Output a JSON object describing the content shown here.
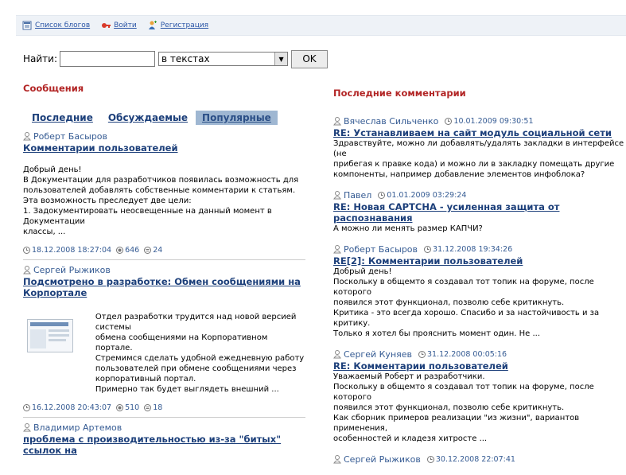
{
  "topnav": {
    "items": [
      {
        "label": "Список блогов",
        "icon": "blog-list-icon"
      },
      {
        "label": "Войти",
        "icon": "key-icon"
      },
      {
        "label": "Регистрация",
        "icon": "register-user-icon"
      }
    ]
  },
  "search": {
    "label": "Найти:",
    "query_value": "",
    "scope_selected": "в текстах",
    "ok_label": "OK"
  },
  "messages": {
    "title": "Сообщения",
    "tabs": [
      {
        "label": "Последние",
        "active": false
      },
      {
        "label": "Обсуждаемые",
        "active": false
      },
      {
        "label": "Популярные",
        "active": true
      }
    ],
    "posts": [
      {
        "author": "Роберт Басыров",
        "title": "Комментарии пользователей",
        "lines": [
          "Добрый день!",
          "В Документации для разработчиков появилась возможность для",
          "пользователей добавлять собственные комментарии к статьям.",
          "Эта возможность преследует две цели:",
          "1. Задокументировать неосвещенные на данный момент в Документации",
          "классы, ..."
        ],
        "date": "18.12.2008 18:27:04",
        "views": "646",
        "comments": "24"
      },
      {
        "author": "Сергей Рыжиков",
        "title": "Подсмотрено в разработке: Обмен сообщениями на Корпортале",
        "lines": [
          "Отдел разработки трудится над новой версией системы",
          "обмена сообщениями на Корпоративном портале.",
          "Стремимся сделать удобной ежедневную работу",
          "пользователей при обмене сообщениями через",
          "корпоративный портал.",
          "Примерно так будет выглядеть внешний ..."
        ],
        "date": "16.12.2008 20:43:07",
        "views": "510",
        "comments": "18"
      },
      {
        "author": "Владимир Артемов",
        "title": "проблема с производительностью из-за \"битых\" ссылок на"
      }
    ]
  },
  "recent_comments": {
    "title": "Последние комментарии",
    "items": [
      {
        "author": "Вячеслав Сильченко",
        "date": "10.01.2009 09:30:51",
        "title": "RE: Устанавливаем на сайт модуль социальной сети",
        "lines": [
          "Здравствуйте, можно ли добавлять/удалять закладки в интерфейсе (не",
          "прибегая к правке кода) и можно ли в закладку помещать другие",
          "компоненты, например добавление элементов инфоблока?"
        ]
      },
      {
        "author": "Павел",
        "date": "01.01.2009 03:29:24",
        "title": "RE: Новая CAPTCHA - усиленная защита от распознавания",
        "lines": [
          "А можно ли менять размер КАПЧИ?"
        ]
      },
      {
        "author": "Роберт Басыров",
        "date": "31.12.2008 19:34:26",
        "title": "RE[2]: Комментарии пользователей",
        "lines": [
          "Добрый день!",
          "Поскольку в общемто я создавал тот топик на форуме, после которого",
          "появился этот функционал, позволю себе критикнуть.",
          "Критика - это всегда хорошо. Спасибо и за настойчивость и за критику.",
          "Только я хотел бы прояснить момент один. Не ..."
        ]
      },
      {
        "author": "Сергей Куняев",
        "date": "31.12.2008 00:05:16",
        "title": "RE: Комментарии пользователей",
        "lines": [
          "Уважаемый Роберт и разработчики.",
          "Поскольку в общемто я создавал тот топик на форуме, после которого",
          "появился этот функционал, позволю себе критикнуть.",
          "Как сборник примеров реализации \"из жизни\", вариантов применения,",
          "особенностей и кладезя хитросте ..."
        ]
      },
      {
        "author": "Сергей Рыжиков",
        "date": "30.12.2008 22:07:41"
      }
    ]
  }
}
